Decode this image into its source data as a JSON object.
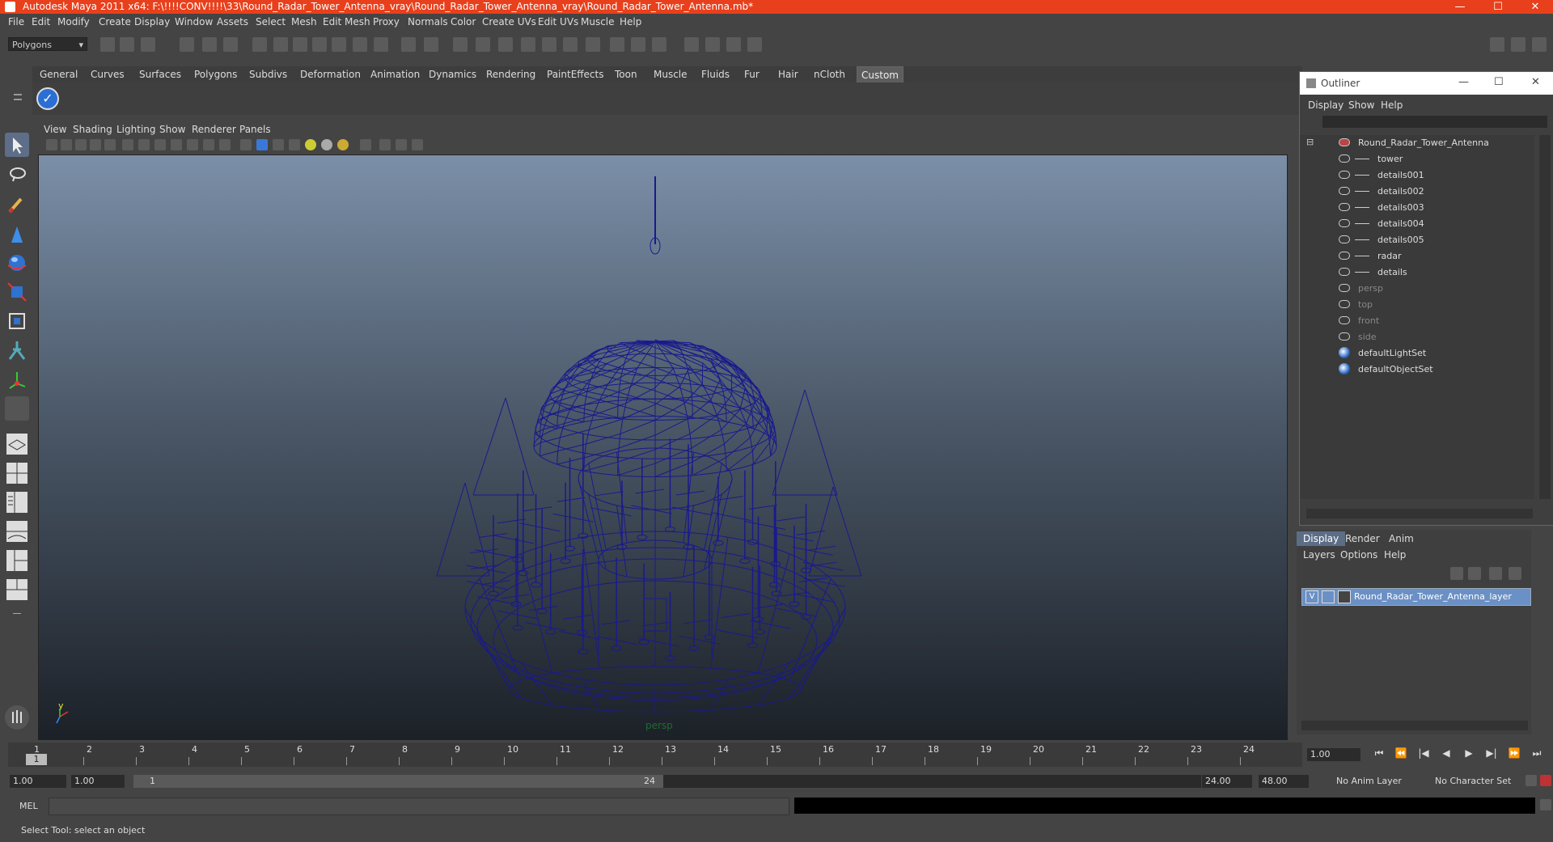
{
  "window": {
    "title": "Autodesk Maya 2011 x64: F:\\!!!!CONV!!!!\\33\\Round_Radar_Tower_Antenna_vray\\Round_Radar_Tower_Antenna_vray\\Round_Radar_Tower_Antenna.mb*",
    "minimize": "—",
    "maximize": "☐",
    "close": "✕"
  },
  "menubar": [
    "File",
    "Edit",
    "Modify",
    "Create",
    "Display",
    "Window",
    "Assets",
    "Select",
    "Mesh",
    "Edit Mesh",
    "Proxy",
    "Normals",
    "Color",
    "Create UVs",
    "Edit UVs",
    "Muscle",
    "Help"
  ],
  "statusline": {
    "mode": "Polygons"
  },
  "shelf": {
    "tabs": [
      "General",
      "Curves",
      "Surfaces",
      "Polygons",
      "Subdivs",
      "Deformation",
      "Animation",
      "Dynamics",
      "Rendering",
      "PaintEffects",
      "Toon",
      "Muscle",
      "Fluids",
      "Fur",
      "Hair",
      "nCloth",
      "Custom"
    ],
    "active_tab": "Custom",
    "icon": "check-icon"
  },
  "viewport": {
    "menu": [
      "View",
      "Shading",
      "Lighting",
      "Show",
      "Renderer",
      "Panels"
    ],
    "camera": "persp",
    "axis_y": "y",
    "wireframe_color": "#1a1a8c"
  },
  "outliner": {
    "title": "Outliner",
    "menu": [
      "Display",
      "Show",
      "Help"
    ],
    "items": [
      {
        "label": "Round_Radar_Tower_Antenna",
        "type": "group",
        "dim": false
      },
      {
        "label": "tower",
        "type": "child",
        "dim": false
      },
      {
        "label": "details001",
        "type": "child",
        "dim": false
      },
      {
        "label": "details002",
        "type": "child",
        "dim": false
      },
      {
        "label": "details003",
        "type": "child",
        "dim": false
      },
      {
        "label": "details004",
        "type": "child",
        "dim": false
      },
      {
        "label": "details005",
        "type": "child",
        "dim": false
      },
      {
        "label": "radar",
        "type": "child",
        "dim": false
      },
      {
        "label": "details",
        "type": "child",
        "dim": false
      },
      {
        "label": "persp",
        "type": "camera",
        "dim": true
      },
      {
        "label": "top",
        "type": "camera",
        "dim": true
      },
      {
        "label": "front",
        "type": "camera",
        "dim": true
      },
      {
        "label": "side",
        "type": "camera",
        "dim": true
      },
      {
        "label": "defaultLightSet",
        "type": "set",
        "dim": false
      },
      {
        "label": "defaultObjectSet",
        "type": "set",
        "dim": false
      }
    ]
  },
  "layer_editor": {
    "tabs": [
      "Display",
      "Render",
      "Anim"
    ],
    "active_tab": "Display",
    "menu": [
      "Layers",
      "Options",
      "Help"
    ],
    "layer": {
      "visible": "V",
      "name": "Round_Radar_Tower_Antenna_layer"
    }
  },
  "timeslider": {
    "ticks": [
      "1",
      "2",
      "3",
      "4",
      "5",
      "6",
      "7",
      "8",
      "9",
      "10",
      "11",
      "12",
      "13",
      "14",
      "15",
      "16",
      "17",
      "18",
      "19",
      "20",
      "21",
      "22",
      "23",
      "24"
    ],
    "current_marker": "1",
    "current_frame": "1.00"
  },
  "range": {
    "start": "1.00",
    "playback_start": "1.00",
    "slider_start": "1",
    "slider_end": "24",
    "playback_end": "24.00",
    "end": "48.00",
    "anim_layer": "No Anim Layer",
    "char_set": "No Character Set"
  },
  "commandline": {
    "label": "MEL"
  },
  "helpline": {
    "text": "Select Tool: select an object"
  }
}
